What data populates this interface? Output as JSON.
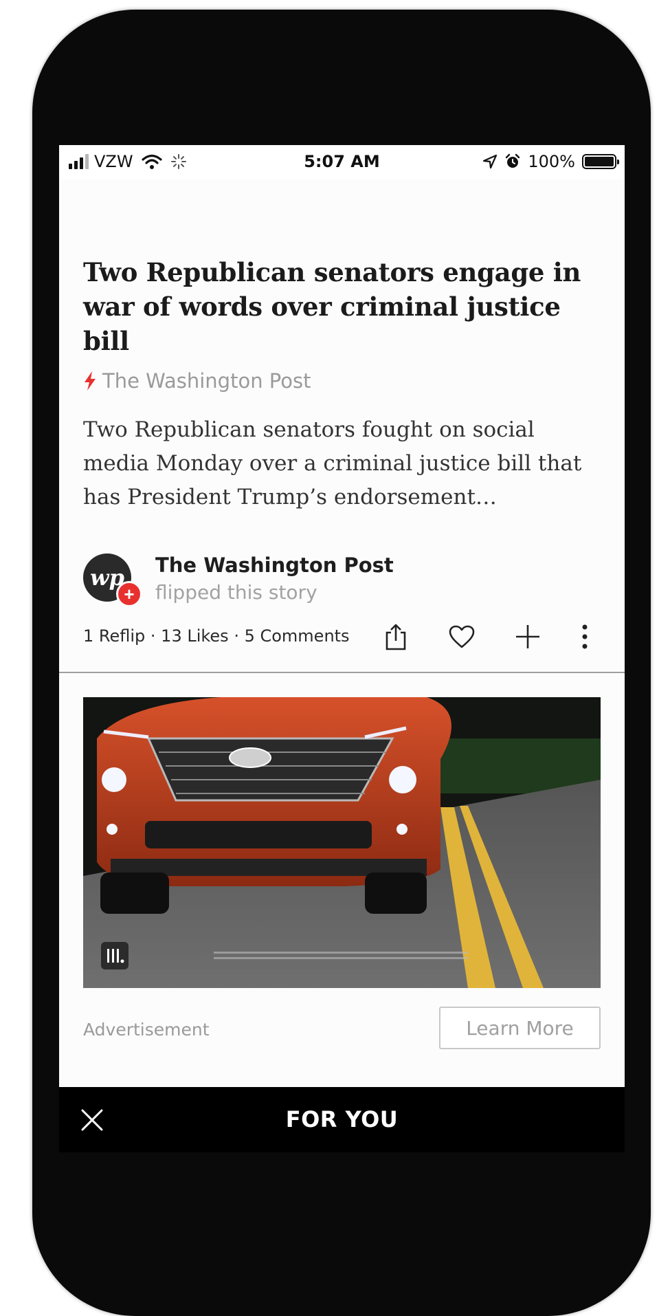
{
  "status_bar": {
    "carrier": "VZW",
    "time": "5:07 AM",
    "battery": "100%",
    "icons": [
      "signal-icon",
      "wifi-icon",
      "activity-spinner-icon",
      "location-arrow-icon",
      "alarm-icon",
      "battery-icon"
    ]
  },
  "article": {
    "headline": "Two Republican senators engage in war of words over criminal justice bill",
    "source": "The Washington Post",
    "excerpt": "Two Republican senators fought on social media Monday over a criminal justice bill that has President Trump’s endorsement…"
  },
  "author": {
    "avatar_text": "wp",
    "follow_symbol": "+",
    "name": "The Washington Post",
    "subtitle": "flipped this story"
  },
  "engagement": {
    "stats": "1 Reflip · 13 Likes · 5 Comments",
    "actions": [
      "share-icon",
      "heart-icon",
      "plus-icon",
      "more-vertical-icon"
    ]
  },
  "ad": {
    "label": "Advertisement",
    "cta": "Learn More",
    "brand_icon": "hyundai-logo"
  },
  "bottom_bar": {
    "title": "FOR YOU",
    "close_icon": "close-icon"
  },
  "colors": {
    "accent_red": "#e8312f",
    "bottom_bar_bg": "#000000",
    "muted_text": "#9a9a9a"
  }
}
